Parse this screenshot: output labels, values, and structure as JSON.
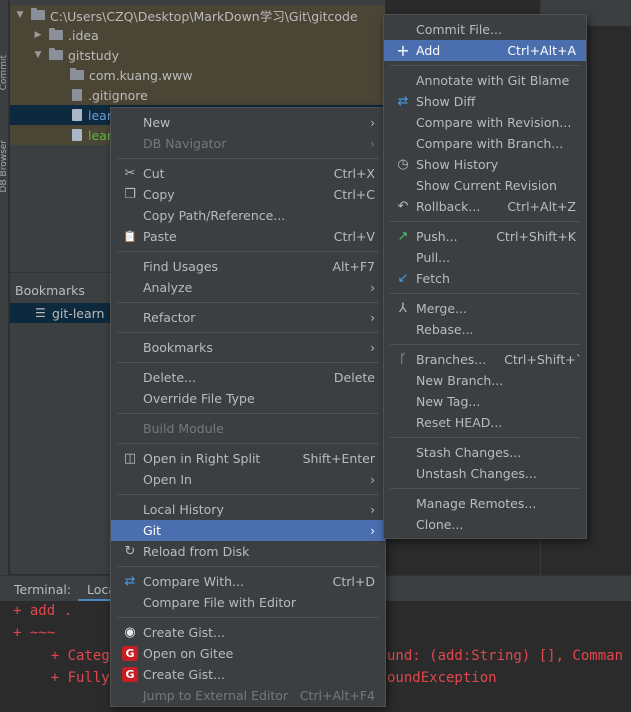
{
  "sidebar_tabs": {
    "commit": "Commit",
    "db_browser": "DB Browser"
  },
  "tree": {
    "root": "C:\\Users\\CZQ\\Desktop\\MarkDown学习\\Git\\gitcode",
    "items": [
      {
        "label": ".idea"
      },
      {
        "label": "gitstudy"
      },
      {
        "label": "com.kuang.www"
      },
      {
        "label": ".gitignore"
      },
      {
        "label": "lean"
      },
      {
        "label": "lean"
      }
    ]
  },
  "bookmarks": {
    "title": "Bookmarks",
    "item": "git-learn"
  },
  "terminal": {
    "label": "Terminal:",
    "tab": "Loca",
    "lines": [
      "+ add .",
      "+ ~~~",
      "    + Categ",
      "    + Fully"
    ],
    "right_lines": [
      "und: (add:String) [], Comman",
      "oundException"
    ]
  },
  "context_menu": {
    "items": [
      {
        "label": "New",
        "submenu": true
      },
      {
        "label": "DB Navigator",
        "submenu": true,
        "disabled": true
      },
      {
        "label": "Cut",
        "shortcut": "Ctrl+X",
        "icon": "✂"
      },
      {
        "label": "Copy",
        "shortcut": "Ctrl+C",
        "icon": "❐"
      },
      {
        "label": "Copy Path/Reference..."
      },
      {
        "label": "Paste",
        "shortcut": "Ctrl+V",
        "icon": "📋"
      },
      {
        "label": "Find Usages",
        "shortcut": "Alt+F7"
      },
      {
        "label": "Analyze",
        "submenu": true
      },
      {
        "label": "Refactor",
        "submenu": true
      },
      {
        "label": "Bookmarks",
        "submenu": true
      },
      {
        "label": "Delete...",
        "shortcut": "Delete"
      },
      {
        "label": "Override File Type"
      },
      {
        "label": "Build Module",
        "disabled": true
      },
      {
        "label": "Open in Right Split",
        "shortcut": "Shift+Enter",
        "icon": "◫"
      },
      {
        "label": "Open In",
        "submenu": true
      },
      {
        "label": "Local History",
        "submenu": true
      },
      {
        "label": "Git",
        "submenu": true,
        "active": true
      },
      {
        "label": "Reload from Disk",
        "icon": "↻"
      },
      {
        "label": "Compare With...",
        "shortcut": "Ctrl+D",
        "icon": "⇄"
      },
      {
        "label": "Compare File with Editor"
      },
      {
        "label": "Create Gist...",
        "icon": "◉"
      },
      {
        "label": "Open on Gitee",
        "icon": "G"
      },
      {
        "label": "Create Gist...",
        "icon": "G"
      },
      {
        "label": "Jump to External Editor",
        "shortcut": "Ctrl+Alt+F4",
        "disabled": true
      }
    ]
  },
  "git_menu": {
    "items": [
      {
        "label": "Commit File..."
      },
      {
        "label": "Add",
        "shortcut": "Ctrl+Alt+A",
        "icon": "+",
        "active": true
      },
      {
        "label": "Annotate with Git Blame"
      },
      {
        "label": "Show Diff",
        "icon": "⇄"
      },
      {
        "label": "Compare with Revision..."
      },
      {
        "label": "Compare with Branch..."
      },
      {
        "label": "Show History",
        "icon": "◷"
      },
      {
        "label": "Show Current Revision"
      },
      {
        "label": "Rollback...",
        "shortcut": "Ctrl+Alt+Z",
        "icon": "↶"
      },
      {
        "label": "Push...",
        "shortcut": "Ctrl+Shift+K",
        "icon": "↗"
      },
      {
        "label": "Pull..."
      },
      {
        "label": "Fetch",
        "icon": "↙"
      },
      {
        "label": "Merge...",
        "icon": "⅄"
      },
      {
        "label": "Rebase..."
      },
      {
        "label": "Branches...",
        "shortcut": "Ctrl+Shift+`",
        "icon": "ᚴ"
      },
      {
        "label": "New Branch..."
      },
      {
        "label": "New Tag..."
      },
      {
        "label": "Reset HEAD..."
      },
      {
        "label": "Stash Changes..."
      },
      {
        "label": "Unstash Changes..."
      },
      {
        "label": "Manage Remotes..."
      },
      {
        "label": "Clone..."
      }
    ]
  },
  "colors": {
    "selection": "#4b6eaf",
    "menu_bg": "#3c3f41",
    "terminal_text": "#e0484d",
    "push_icon": "#4ec36f",
    "diff_icon": "#4a9be8",
    "gitee": "#c71d23"
  }
}
